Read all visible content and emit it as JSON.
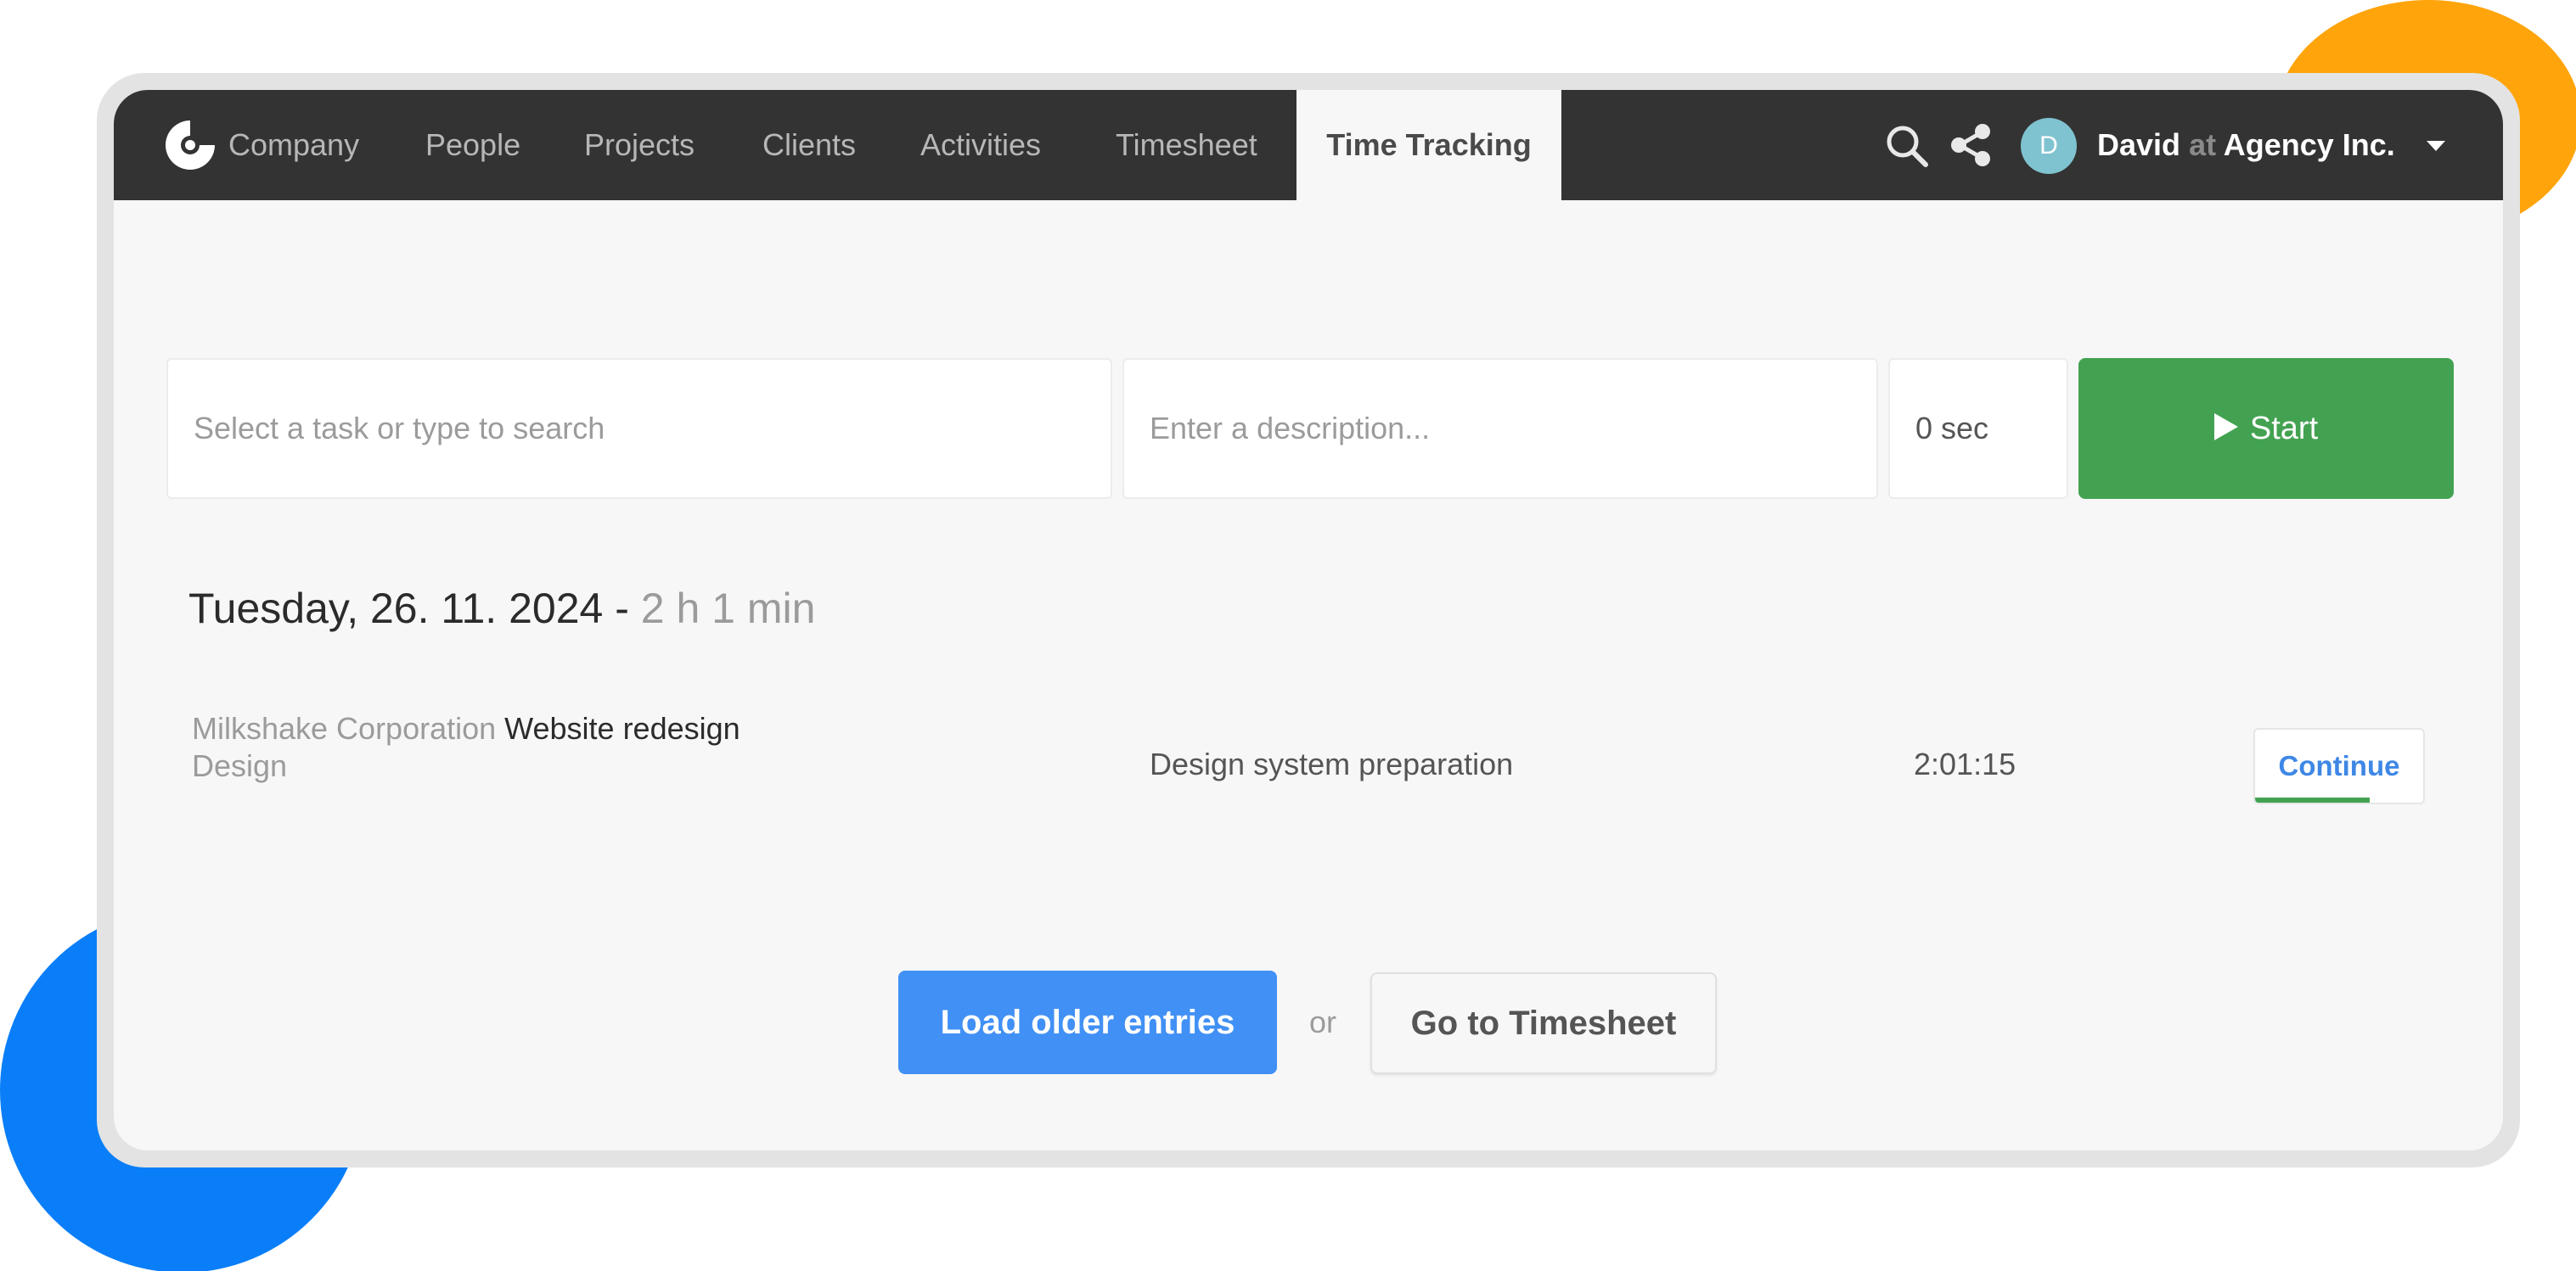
{
  "nav": {
    "logo_icon": "company-logo-icon",
    "items": [
      {
        "label": "Company"
      },
      {
        "label": "People"
      },
      {
        "label": "Projects"
      },
      {
        "label": "Clients"
      },
      {
        "label": "Activities"
      },
      {
        "label": "Timesheet"
      },
      {
        "label": "Time Tracking",
        "active": true
      }
    ],
    "icons": [
      "search-icon",
      "share-icon",
      "caret-down-icon"
    ],
    "user": {
      "avatar_initial": "D",
      "name": "David",
      "at": "at",
      "organization": "Agency Inc."
    }
  },
  "tracker": {
    "task_placeholder": "Select a task or type to search",
    "description_placeholder": "Enter a description...",
    "duration": "0 sec",
    "start_label": "Start"
  },
  "day": {
    "date": "Tuesday, 26. 11. 2024",
    "separator": " - ",
    "total": "2 h 1 min",
    "entries": [
      {
        "client": "Milkshake Corporation",
        "project": "Website redesign",
        "activity": "Design",
        "description": "Design system preparation",
        "duration": "2:01:15",
        "action_label": "Continue",
        "progress": 0.68
      }
    ]
  },
  "actions": {
    "load_older_label": "Load older entries",
    "or_label": "or",
    "timesheet_label": "Go to Timesheet"
  },
  "colors": {
    "nav_bg": "#333333",
    "start_green": "#43a251",
    "load_blue": "#4190f5",
    "continue_blue": "#3e87e6",
    "decor_orange": "#ffa40b",
    "decor_blue": "#0a7ef8"
  }
}
